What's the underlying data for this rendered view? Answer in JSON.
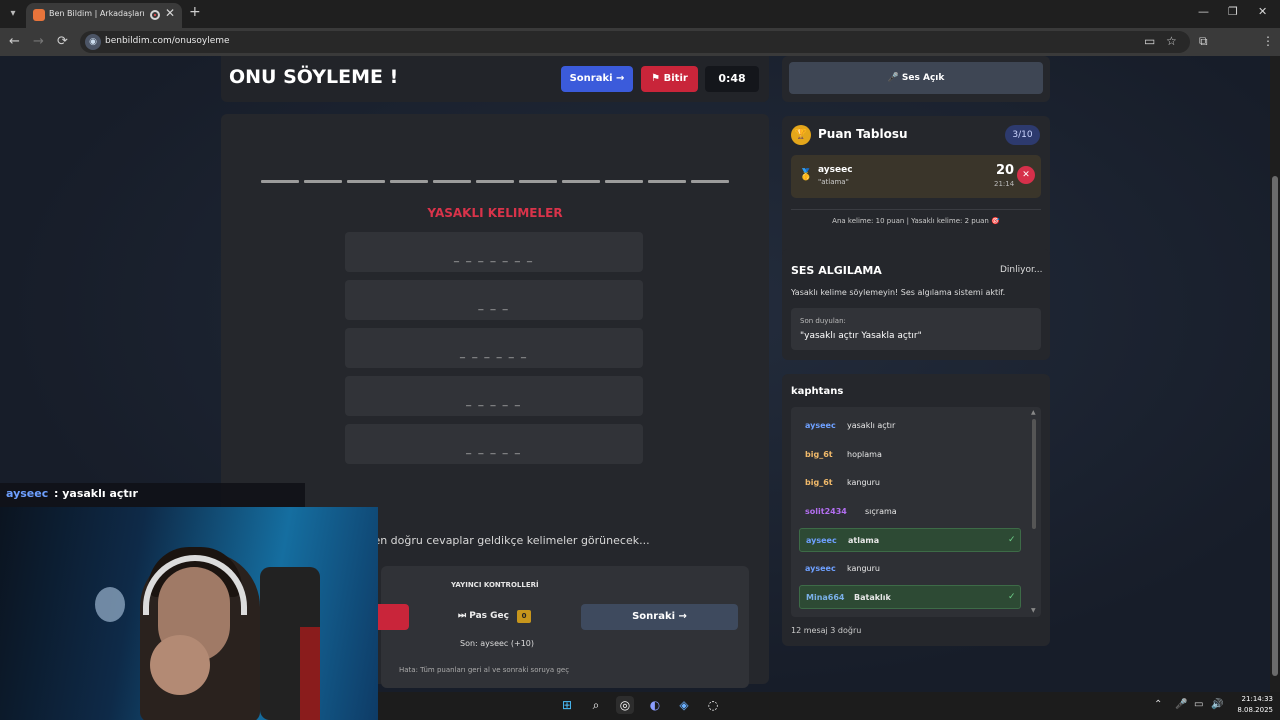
{
  "browser": {
    "tab_title": "Ben Bildim | Arkadaşlarınla",
    "tab_close": "✕",
    "new_tab": "+",
    "url": "benbildim.com/onusoyleme",
    "nav_back": "←",
    "nav_forward": "→",
    "nav_reload": "⟳",
    "win_minimize": "—",
    "win_restore": "❐",
    "win_close": "✕"
  },
  "game": {
    "title": "ONU SÖYLEME !",
    "next_label": "Sonraki →",
    "end_label": "Bitir",
    "timer": "0:48",
    "answer_dash_count": 11,
    "forbidden_title": "YASAKLI KELIMELER",
    "forbidden_words": [
      "_ _ _ _ _ _ _",
      "_ _ _",
      "_ _ _ _ _ _",
      "_ _ _ _ _",
      "_ _ _ _ _"
    ],
    "hint": "Chat'ten doğru cevaplar geldikçe kelimeler görünecek..."
  },
  "controls": {
    "title": "YAYINCI KONTROLLERİ",
    "pass_label": "⏭ Pas Geç",
    "pass_count": "0",
    "next_label": "Sonraki →",
    "last": "Son: ayseec (+10)",
    "help": "Hata: Tüm puanları geri al ve sonraki soruya geç"
  },
  "sound": {
    "label": "🎤 Ses Açık"
  },
  "leaderboard": {
    "title": "Puan Tablosu",
    "count": "3/10",
    "entry": {
      "name": "ayseec",
      "word": "\"atlama\"",
      "score": "20",
      "time": "21:14"
    },
    "info": "Ana kelime: 10 puan | Yasaklı kelime: 2 puan 🎯"
  },
  "speech": {
    "title": "SES ALGILAMA",
    "status": "Dinliyor...",
    "description": "Yasaklı kelime söylemeyin! Ses algılama sistemi aktif.",
    "last_label": "Son duyulan:",
    "last_text": "\"yasaklı açtır Yasakla açtır\""
  },
  "chat": {
    "title": "kaphtans",
    "messages": [
      {
        "user": "ayseec",
        "text": "yasaklı açtır",
        "color": "#6ea0ff",
        "correct": false
      },
      {
        "user": "big_6t",
        "text": "hoplama",
        "color": "#f0b96a",
        "correct": false
      },
      {
        "user": "big_6t",
        "text": "kanguru",
        "color": "#f0b96a",
        "correct": false
      },
      {
        "user": "solit2434",
        "text": "sıçrama",
        "color": "#b26ef0",
        "correct": false
      },
      {
        "user": "ayseec",
        "text": "atlama",
        "color": "#6ea0ff",
        "correct": true
      },
      {
        "user": "ayseec",
        "text": "kanguru",
        "color": "#6ea0ff",
        "correct": false
      },
      {
        "user": "Mina664",
        "text": "Bataklık",
        "color": "#7ab0e8",
        "correct": true
      }
    ],
    "stats": "12 mesaj    3 doğru"
  },
  "overlay": {
    "user": "ayseec",
    "text": ": yasaklı açtır"
  },
  "taskbar": {
    "time": "21:14:33",
    "date": "8.08.2025"
  }
}
